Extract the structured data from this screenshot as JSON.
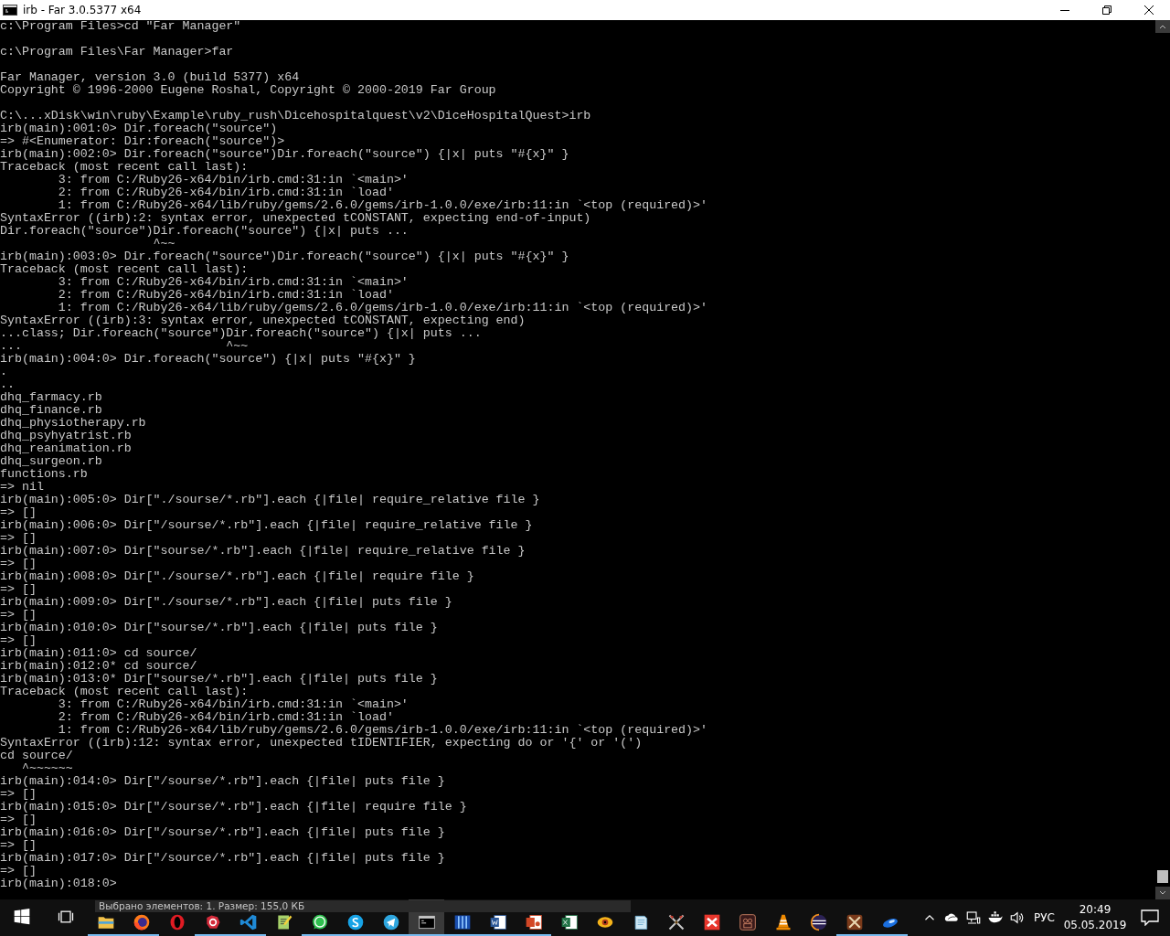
{
  "window": {
    "title": "irb - Far 3.0.5377 x64"
  },
  "console": {
    "lines": [
      {
        "kind": "text",
        "text": "c:\\Program Files>cd \"Far Manager\""
      },
      {
        "kind": "blank"
      },
      {
        "kind": "text",
        "text": "c:\\Program Files\\Far Manager>far"
      },
      {
        "kind": "blank"
      },
      {
        "kind": "text",
        "text": "Far Manager, version 3.0 (build 5377) x64"
      },
      {
        "kind": "text",
        "text": "Copyright © 1996-2000 Eugene Roshal, Copyright © 2000-2019 Far Group"
      },
      {
        "kind": "blank"
      },
      {
        "kind": "text",
        "text": "C:\\...xDisk\\win\\ruby\\Example\\ruby_rush\\Dicehospitalquest\\v2\\DiceHospitalQuest>irb"
      },
      {
        "kind": "text",
        "text": "irb(main):001:0> Dir.foreach(\"source\")"
      },
      {
        "kind": "text",
        "text": "=> #<Enumerator: Dir:foreach(\"source\")>"
      },
      {
        "kind": "text",
        "text": "irb(main):002:0> Dir.foreach(\"source\")Dir.foreach(\"source\") {|x| puts \"#{x}\" }"
      },
      {
        "kind": "text",
        "text": "Traceback (most recent call last):"
      },
      {
        "kind": "text",
        "text": "        3: from C:/Ruby26-x64/bin/irb.cmd:31:in `<main>'"
      },
      {
        "kind": "text",
        "text": "        2: from C:/Ruby26-x64/bin/irb.cmd:31:in `load'"
      },
      {
        "kind": "text",
        "text": "        1: from C:/Ruby26-x64/lib/ruby/gems/2.6.0/gems/irb-1.0.0/exe/irb:11:in `<top (required)>'"
      },
      {
        "kind": "text",
        "text": "SyntaxError ((irb):2: syntax error, unexpected tCONSTANT, expecting end-of-input)"
      },
      {
        "kind": "text",
        "text": "Dir.foreach(\"source\")Dir.foreach(\"source\") {|x| puts ..."
      },
      {
        "kind": "text",
        "text": "                     ^~~"
      },
      {
        "kind": "text",
        "text": "irb(main):003:0> Dir.foreach(\"source\")Dir.foreach(\"source\") {|x| puts \"#{x}\" }"
      },
      {
        "kind": "text",
        "text": "Traceback (most recent call last):"
      },
      {
        "kind": "text",
        "text": "        3: from C:/Ruby26-x64/bin/irb.cmd:31:in `<main>'"
      },
      {
        "kind": "text",
        "text": "        2: from C:/Ruby26-x64/bin/irb.cmd:31:in `load'"
      },
      {
        "kind": "text",
        "text": "        1: from C:/Ruby26-x64/lib/ruby/gems/2.6.0/gems/irb-1.0.0/exe/irb:11:in `<top (required)>'"
      },
      {
        "kind": "text",
        "text": "SyntaxError ((irb):3: syntax error, unexpected tCONSTANT, expecting end)"
      },
      {
        "kind": "text",
        "text": "...class; Dir.foreach(\"source\")Dir.foreach(\"source\") {|x| puts ..."
      },
      {
        "kind": "text",
        "text": "...                            ^~~"
      },
      {
        "kind": "text",
        "text": "irb(main):004:0> Dir.foreach(\"source\") {|x| puts \"#{x}\" }"
      },
      {
        "kind": "text",
        "text": "."
      },
      {
        "kind": "text",
        "text": ".."
      },
      {
        "kind": "text",
        "text": "dhq_farmacy.rb"
      },
      {
        "kind": "text",
        "text": "dhq_finance.rb"
      },
      {
        "kind": "text",
        "text": "dhq_physiotherapy.rb"
      },
      {
        "kind": "text",
        "text": "dhq_psyhyatrist.rb"
      },
      {
        "kind": "text",
        "text": "dhq_reanimation.rb"
      },
      {
        "kind": "text",
        "text": "dhq_surgeon.rb"
      },
      {
        "kind": "text",
        "text": "functions.rb"
      },
      {
        "kind": "text",
        "text": "=> nil"
      },
      {
        "kind": "text",
        "text": "irb(main):005:0> Dir[\"./sourse/*.rb\"].each {|file| require_relative file }"
      },
      {
        "kind": "text",
        "text": "=> []"
      },
      {
        "kind": "text",
        "text": "irb(main):006:0> Dir[\"/sourse/*.rb\"].each {|file| require_relative file }"
      },
      {
        "kind": "text",
        "text": "=> []"
      },
      {
        "kind": "text",
        "text": "irb(main):007:0> Dir[\"sourse/*.rb\"].each {|file| require_relative file }"
      },
      {
        "kind": "text",
        "text": "=> []"
      },
      {
        "kind": "text",
        "text": "irb(main):008:0> Dir[\"./sourse/*.rb\"].each {|file| require file }"
      },
      {
        "kind": "text",
        "text": "=> []"
      },
      {
        "kind": "text",
        "text": "irb(main):009:0> Dir[\"./sourse/*.rb\"].each {|file| puts file }"
      },
      {
        "kind": "text",
        "text": "=> []"
      },
      {
        "kind": "text",
        "text": "irb(main):010:0> Dir[\"sourse/*.rb\"].each {|file| puts file }"
      },
      {
        "kind": "text",
        "text": "=> []"
      },
      {
        "kind": "text",
        "text": "irb(main):011:0> cd source/"
      },
      {
        "kind": "text",
        "text": "irb(main):012:0* cd source/"
      },
      {
        "kind": "text",
        "text": "irb(main):013:0* Dir[\"sourse/*.rb\"].each {|file| puts file }"
      },
      {
        "kind": "text",
        "text": "Traceback (most recent call last):"
      },
      {
        "kind": "text",
        "text": "        3: from C:/Ruby26-x64/bin/irb.cmd:31:in `<main>'"
      },
      {
        "kind": "text",
        "text": "        2: from C:/Ruby26-x64/bin/irb.cmd:31:in `load'"
      },
      {
        "kind": "text",
        "text": "        1: from C:/Ruby26-x64/lib/ruby/gems/2.6.0/gems/irb-1.0.0/exe/irb:11:in `<top (required)>'"
      },
      {
        "kind": "text",
        "text": "SyntaxError ((irb):12: syntax error, unexpected tIDENTIFIER, expecting do or '{' or '(')"
      },
      {
        "kind": "text",
        "text": "cd source/"
      },
      {
        "kind": "text",
        "text": "   ^~~~~~~"
      },
      {
        "kind": "text",
        "text": "irb(main):014:0> Dir[\"/sourse/*.rb\"].each {|file| puts file }"
      },
      {
        "kind": "text",
        "text": "=> []"
      },
      {
        "kind": "text",
        "text": "irb(main):015:0> Dir[\"/sourse/*.rb\"].each {|file| require file }"
      },
      {
        "kind": "text",
        "text": "=> []"
      },
      {
        "kind": "text",
        "text": "irb(main):016:0> Dir[\"/sourse/*.rb\"].each {|file| puts file }"
      },
      {
        "kind": "text",
        "text": "=> []"
      },
      {
        "kind": "text",
        "text": "irb(main):017:0> Dir[\"/source/*.rb\"].each {|file| puts file }"
      },
      {
        "kind": "text",
        "text": "=> []"
      },
      {
        "kind": "text",
        "text": "irb(main):018:0>"
      }
    ]
  },
  "taskbar": {
    "tooltip": "Выбрано элементов: 1. Размер: 155,0 КБ",
    "apps": [
      {
        "kind": "start",
        "running": false,
        "active": false
      },
      {
        "kind": "taskview",
        "running": false,
        "active": false
      },
      {
        "kind": "folder",
        "running": true,
        "active": false
      },
      {
        "kind": "firefox",
        "running": true,
        "active": false
      },
      {
        "kind": "opera",
        "running": false,
        "active": false
      },
      {
        "kind": "redapp",
        "running": true,
        "active": false
      },
      {
        "kind": "vscode",
        "running": true,
        "active": false
      },
      {
        "kind": "notepadpp",
        "running": false,
        "active": false
      },
      {
        "kind": "whatsapp",
        "running": true,
        "active": false
      },
      {
        "kind": "skype",
        "running": true,
        "active": false
      },
      {
        "kind": "telegram",
        "running": true,
        "active": false
      },
      {
        "kind": "console",
        "running": true,
        "active": true
      },
      {
        "kind": "columns",
        "running": true,
        "active": false
      },
      {
        "kind": "word",
        "running": true,
        "active": false
      },
      {
        "kind": "powerpoint",
        "running": true,
        "active": false
      },
      {
        "kind": "excel",
        "running": false,
        "active": false
      },
      {
        "kind": "eye",
        "running": false,
        "active": false
      },
      {
        "kind": "notepad",
        "running": false,
        "active": false
      },
      {
        "kind": "swords",
        "running": false,
        "active": false
      },
      {
        "kind": "xmind",
        "running": false,
        "active": false
      },
      {
        "kind": "film",
        "running": false,
        "active": false
      },
      {
        "kind": "vlc",
        "running": false,
        "active": false
      },
      {
        "kind": "eclipse",
        "running": false,
        "active": false
      },
      {
        "kind": "game",
        "running": true,
        "active": false
      },
      {
        "kind": "disc",
        "running": true,
        "active": false
      }
    ],
    "tray": {
      "icons": [
        {
          "kind": "chevron"
        },
        {
          "kind": "cloud"
        },
        {
          "kind": "network"
        },
        {
          "kind": "whale"
        },
        {
          "kind": "speaker"
        }
      ],
      "language": "РУС",
      "time": "20:49",
      "date": "05.05.2019"
    }
  }
}
